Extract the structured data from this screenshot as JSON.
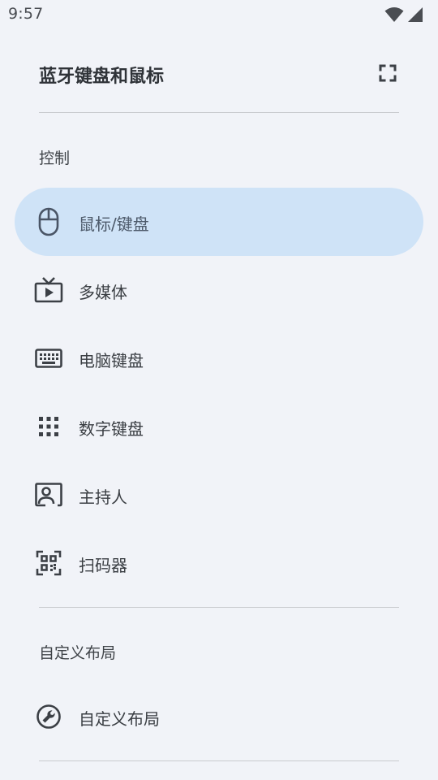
{
  "status_bar": {
    "time": "9:57",
    "icons": [
      "wifi-icon",
      "cell-signal-icon"
    ]
  },
  "header": {
    "title": "蓝牙键盘和鼠标",
    "fullscreen_icon": "fullscreen-icon"
  },
  "sections": {
    "control": {
      "label": "控制",
      "items": [
        {
          "label": "鼠标/键盘",
          "icon": "mouse-icon",
          "active": true
        },
        {
          "label": "多媒体",
          "icon": "tv-play-icon",
          "active": false
        },
        {
          "label": "电脑键盘",
          "icon": "keyboard-icon",
          "active": false
        },
        {
          "label": "数字键盘",
          "icon": "numpad-grid-icon",
          "active": false
        },
        {
          "label": "主持人",
          "icon": "presenter-icon",
          "active": false
        },
        {
          "label": "扫码器",
          "icon": "qr-scanner-icon",
          "active": false
        }
      ]
    },
    "custom": {
      "label": "自定义布局",
      "items": [
        {
          "label": "自定义布局",
          "icon": "wrench-icon",
          "active": false
        }
      ]
    }
  },
  "colors": {
    "background": "#f1f3f8",
    "active_item_bg": "#cfe3f7",
    "divider": "#c8cace",
    "icon": "#3c4046"
  }
}
